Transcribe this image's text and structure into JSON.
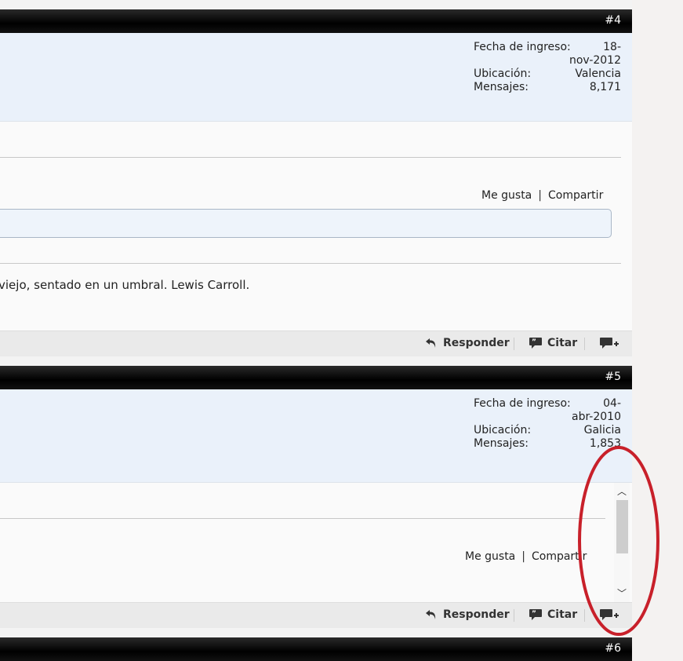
{
  "posts": [
    {
      "number": "#4",
      "join_label": "Fecha de ingreso:",
      "join_value_1": "18-",
      "join_value_2": "nov-2012",
      "location_label": "Ubicación:",
      "location_value": "Valencia",
      "messages_label": "Mensajes:",
      "messages_value": "8,171",
      "like_label": "Me gusta",
      "share_label": "Compartir",
      "signature": "viejo, sentado en un umbral. Lewis Carroll.",
      "reply_label": "Responder",
      "quote_label": "Citar"
    },
    {
      "number": "#5",
      "join_label": "Fecha de ingreso:",
      "join_value_1": "04-",
      "join_value_2": "abr-2010",
      "location_label": "Ubicación:",
      "location_value": "Galicia",
      "messages_label": "Mensajes:",
      "messages_value": "1,853",
      "like_label": "Me gusta",
      "share_label": "Compartir",
      "reply_label": "Responder",
      "quote_label": "Citar"
    },
    {
      "number": "#6"
    }
  ],
  "separator": "|",
  "annotation_color": "#c8202a"
}
